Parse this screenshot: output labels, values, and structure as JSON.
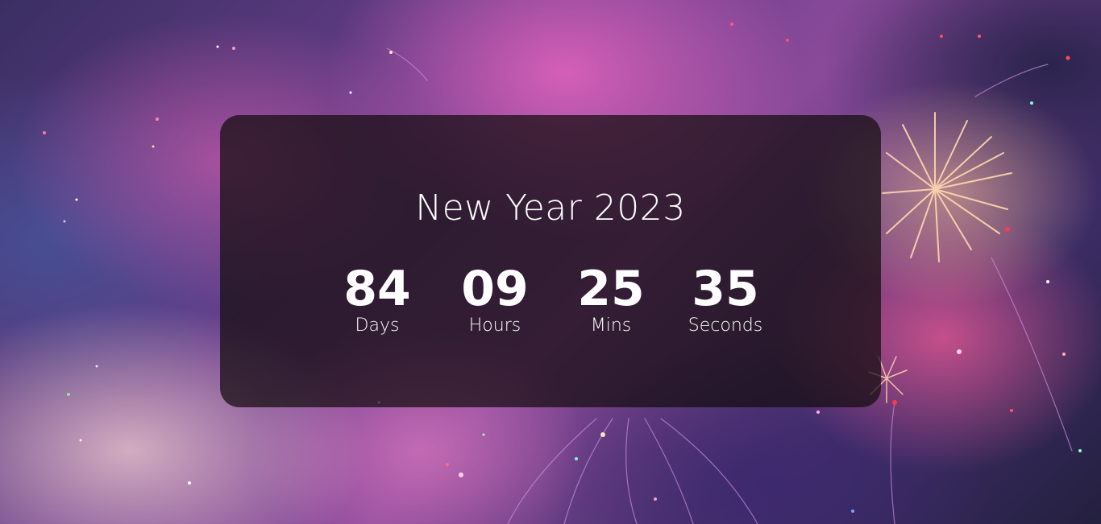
{
  "countdown": {
    "title": "New Year 2023",
    "units": [
      {
        "value": "84",
        "label": "Days"
      },
      {
        "value": "09",
        "label": "Hours"
      },
      {
        "value": "25",
        "label": "Mins"
      },
      {
        "value": "35",
        "label": "Seconds"
      }
    ]
  },
  "theme": {
    "card_background": "#140c0e",
    "text_color": "#ffffff",
    "background_accent": "#e06ab8"
  },
  "background": {
    "image": "fireworks-photo"
  }
}
